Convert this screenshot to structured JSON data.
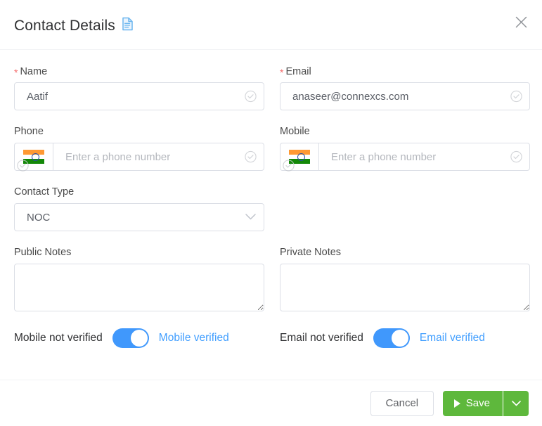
{
  "header": {
    "title": "Contact Details",
    "doc_icon": "document-icon",
    "close_icon": "close-icon"
  },
  "fields": {
    "name": {
      "label": "Name",
      "required_marker": "*",
      "value": "Aatif",
      "placeholder": "",
      "suffix_icon": "check-circle-icon"
    },
    "email": {
      "label": "Email",
      "required_marker": "*",
      "value": "anaseer@connexcs.com",
      "placeholder": "",
      "suffix_icon": "check-circle-icon"
    },
    "phone": {
      "label": "Phone",
      "value": "",
      "placeholder": "Enter a phone number",
      "country_flag": "flag-india-icon",
      "flag_badge_icon": "check-circle-icon",
      "suffix_icon": "check-circle-icon"
    },
    "mobile": {
      "label": "Mobile",
      "value": "",
      "placeholder": "Enter a phone number",
      "country_flag": "flag-india-icon",
      "flag_badge_icon": "check-circle-icon",
      "suffix_icon": "check-circle-icon"
    },
    "contact_type": {
      "label": "Contact Type",
      "value": "NOC",
      "caret_icon": "chevron-down-icon"
    },
    "public_notes": {
      "label": "Public Notes",
      "value": "",
      "placeholder": ""
    },
    "private_notes": {
      "label": "Private Notes",
      "value": "",
      "placeholder": ""
    }
  },
  "toggles": {
    "mobile": {
      "off_label": "Mobile not verified",
      "on_label": "Mobile verified",
      "state": "on"
    },
    "email": {
      "off_label": "Email not verified",
      "on_label": "Email verified",
      "state": "on"
    }
  },
  "footer": {
    "cancel_label": "Cancel",
    "save_label": "Save",
    "save_icon": "play-icon",
    "save_caret_icon": "chevron-down-icon"
  },
  "colors": {
    "accent_blue": "#409eff",
    "save_green": "#5eb83c",
    "required_red": "#f56c6c",
    "border_gray": "#dcdfe6"
  }
}
